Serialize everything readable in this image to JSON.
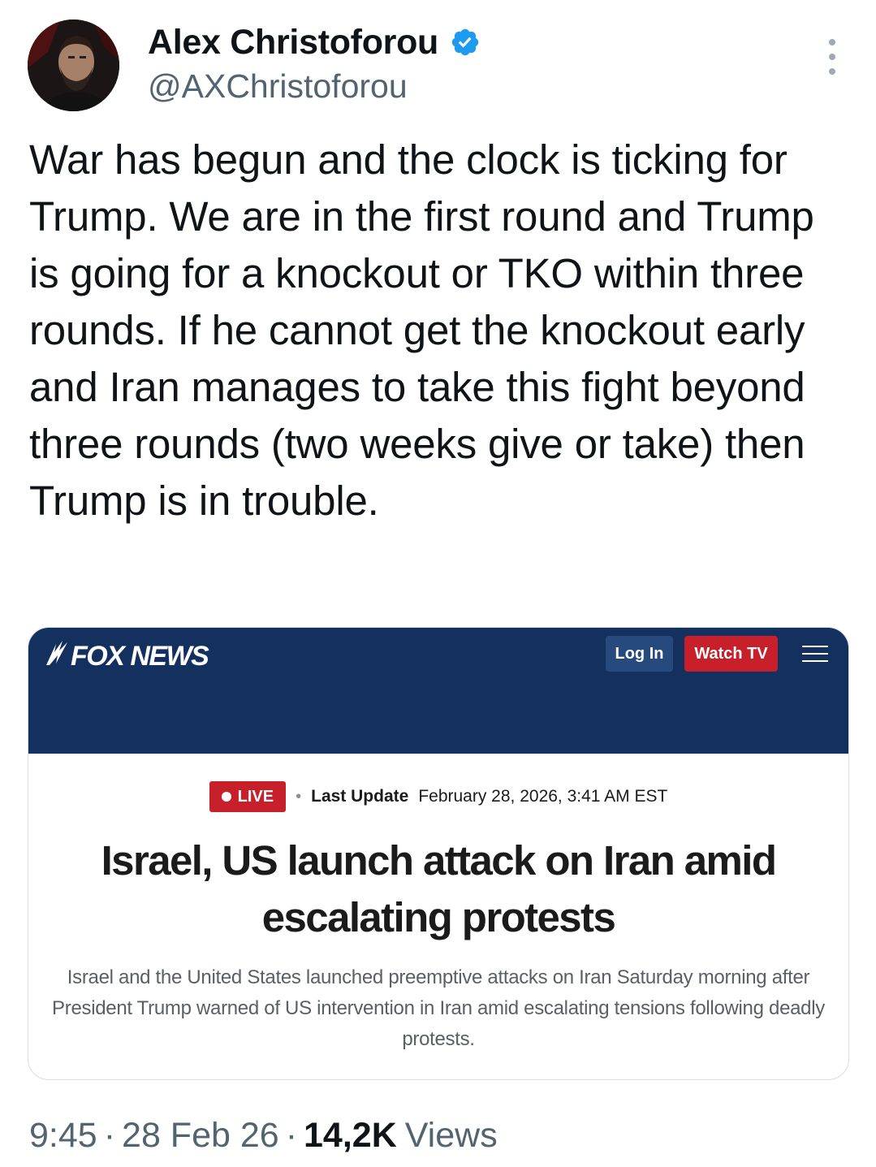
{
  "author": {
    "display_name": "Alex Christoforou",
    "handle": "@AXChristoforou",
    "verified": true
  },
  "tweet": {
    "text": "War has begun and the clock is ticking for Trump. We are in the first round and Trump is going for a knockout or TKO within three rounds. If he cannot get the knockout early and Iran manages to take this fight beyond three rounds (two weeks give or take) then Trump is in trouble."
  },
  "card": {
    "site_logo": "FOX NEWS",
    "login_label": "Log In",
    "watch_tv_label": "Watch TV",
    "live_label": "LIVE",
    "last_update_label": "Last Update",
    "last_update_date": "February 28, 2026, 3:41 AM EST",
    "headline": "Israel, US launch attack on Iran amid escalating protests",
    "summary": "Israel and the United States launched preemptive attacks on Iran Saturday morning after President Trump warned of US intervention in Iran amid escalating tensions following deadly protests."
  },
  "footer": {
    "time": "9:45",
    "date": "28 Feb 26",
    "views_count": "14,2K",
    "views_label": "Views"
  },
  "colors": {
    "verified_blue": "#1d9bf0",
    "fox_navy": "#13305f",
    "fox_red": "#c7202b",
    "secondary_text": "#536471"
  },
  "icons": {
    "verified": "verified-badge-icon",
    "more": "more-options-icon",
    "menu": "hamburger-menu-icon",
    "live": "live-dot-icon"
  }
}
